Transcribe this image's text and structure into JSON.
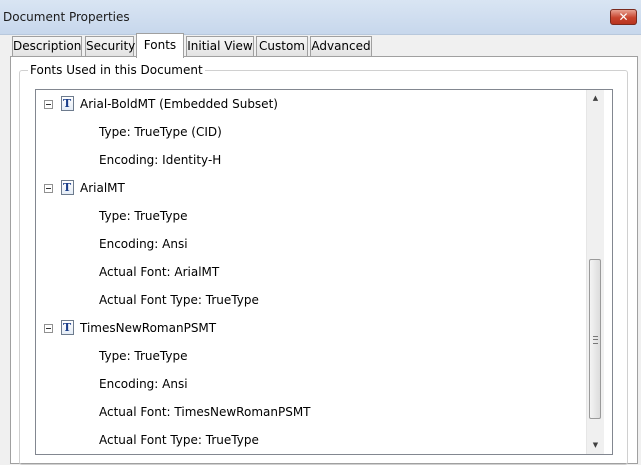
{
  "window": {
    "title": "Document Properties",
    "close_symbol": "✕"
  },
  "tabs": [
    {
      "label": "Description"
    },
    {
      "label": "Security"
    },
    {
      "label": "Fonts",
      "active": true
    },
    {
      "label": "Initial View"
    },
    {
      "label": "Custom"
    },
    {
      "label": "Advanced"
    }
  ],
  "group": {
    "label": "Fonts Used in this Document"
  },
  "fonts": [
    {
      "name": "Arial-BoldMT (Embedded Subset)",
      "icon": "truetype-font-icon",
      "details": [
        "Type: TrueType (CID)",
        "Encoding: Identity-H"
      ]
    },
    {
      "name": "ArialMT",
      "icon": "truetype-font-icon",
      "details": [
        "Type: TrueType",
        "Encoding: Ansi",
        "Actual Font: ArialMT",
        "Actual Font Type: TrueType"
      ]
    },
    {
      "name": "TimesNewRomanPSMT",
      "icon": "truetype-font-icon",
      "details": [
        "Type: TrueType",
        "Encoding: Ansi",
        "Actual Font: TimesNewRomanPSMT",
        "Actual Font Type: TrueType"
      ]
    }
  ],
  "scrollbar": {
    "up_symbol": "▲",
    "down_symbol": "▼",
    "position_fraction": 1.0
  },
  "colors": {
    "title_bar": "#c7d7ec",
    "close_button": "#c8442e",
    "font_icon": "#1c3f8a"
  }
}
